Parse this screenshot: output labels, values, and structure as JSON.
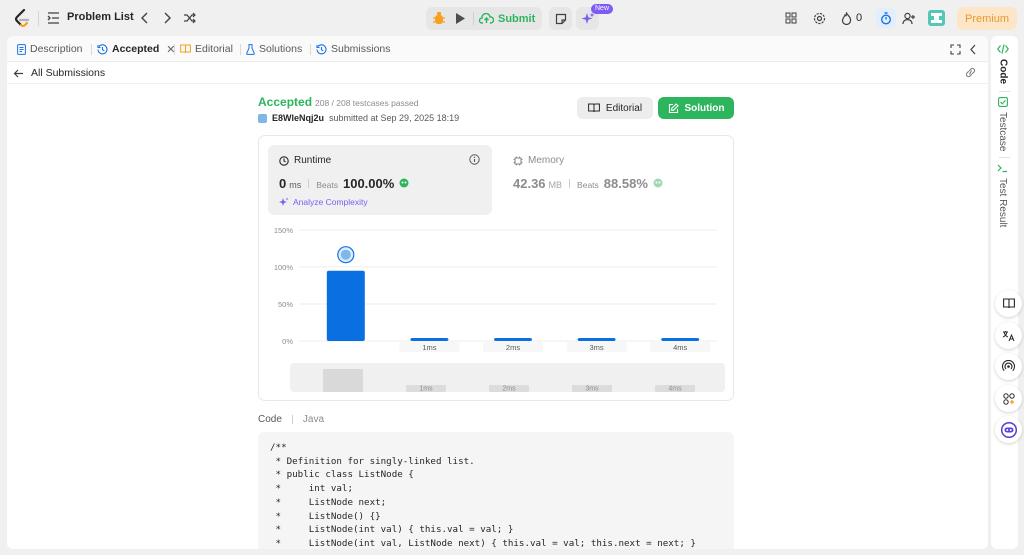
{
  "topbar": {
    "problem_list_label": "Problem List",
    "submit_label": "Submit",
    "new_badge": "New",
    "streak_count": "0",
    "premium_label": "Premium",
    "colors": {
      "submit": "#2db55d",
      "premium_bg": "#fde6c8",
      "premium_text": "#e59b2c"
    },
    "icons": [
      "logo",
      "problem-list-icon",
      "prev-icon",
      "next-icon",
      "shuffle-icon",
      "debug-icon",
      "run-icon",
      "upload-icon",
      "notes-icon",
      "sparkle-icon",
      "layout-icon",
      "settings-icon",
      "fire-icon",
      "timer-icon",
      "add-user-icon",
      "avatar"
    ]
  },
  "tabs": {
    "description": "Description",
    "accepted": "Accepted",
    "editorial": "Editorial",
    "solutions": "Solutions",
    "submissions": "Submissions"
  },
  "subbar": {
    "back_label": "All Submissions"
  },
  "result": {
    "status": "Accepted",
    "testcases": "208 / 208 testcases passed",
    "username": "E8WleNqj2u",
    "submitted": "submitted at Sep 29, 2025 18:19",
    "editorial_btn": "Editorial",
    "solution_btn": "Solution"
  },
  "runtime": {
    "title": "Runtime",
    "value": "0",
    "unit": "ms",
    "beats_label": "Beats",
    "beats_value": "100.00%",
    "analyze_label": "Analyze Complexity"
  },
  "memory": {
    "title": "Memory",
    "value": "42.36",
    "unit": "MB",
    "beats_label": "Beats",
    "beats_value": "88.58%"
  },
  "chart_data": {
    "type": "bar",
    "categories": [
      "0ms",
      "1ms",
      "2ms",
      "3ms",
      "4ms"
    ],
    "tick_labels": [
      "",
      "1ms",
      "2ms",
      "3ms",
      "4ms"
    ],
    "values": [
      95,
      4,
      4,
      4,
      4
    ],
    "yticks": [
      "150%",
      "100%",
      "50%",
      "0%"
    ],
    "ylim": [
      0,
      150
    ],
    "highlight_index": 0,
    "bar_color": "#0a6fe0",
    "grid": true
  },
  "code": {
    "label": "Code",
    "language": "Java",
    "lines": [
      "/**",
      " * Definition for singly-linked list.",
      " * public class ListNode {",
      " *     int val;",
      " *     ListNode next;",
      " *     ListNode() {}",
      " *     ListNode(int val) { this.val = val; }",
      " *     ListNode(int val, ListNode next) { this.val = val; this.next = next; }"
    ]
  },
  "right_tabs": {
    "code": "Code",
    "testcase": "Testcase",
    "test_result": "Test Result"
  }
}
